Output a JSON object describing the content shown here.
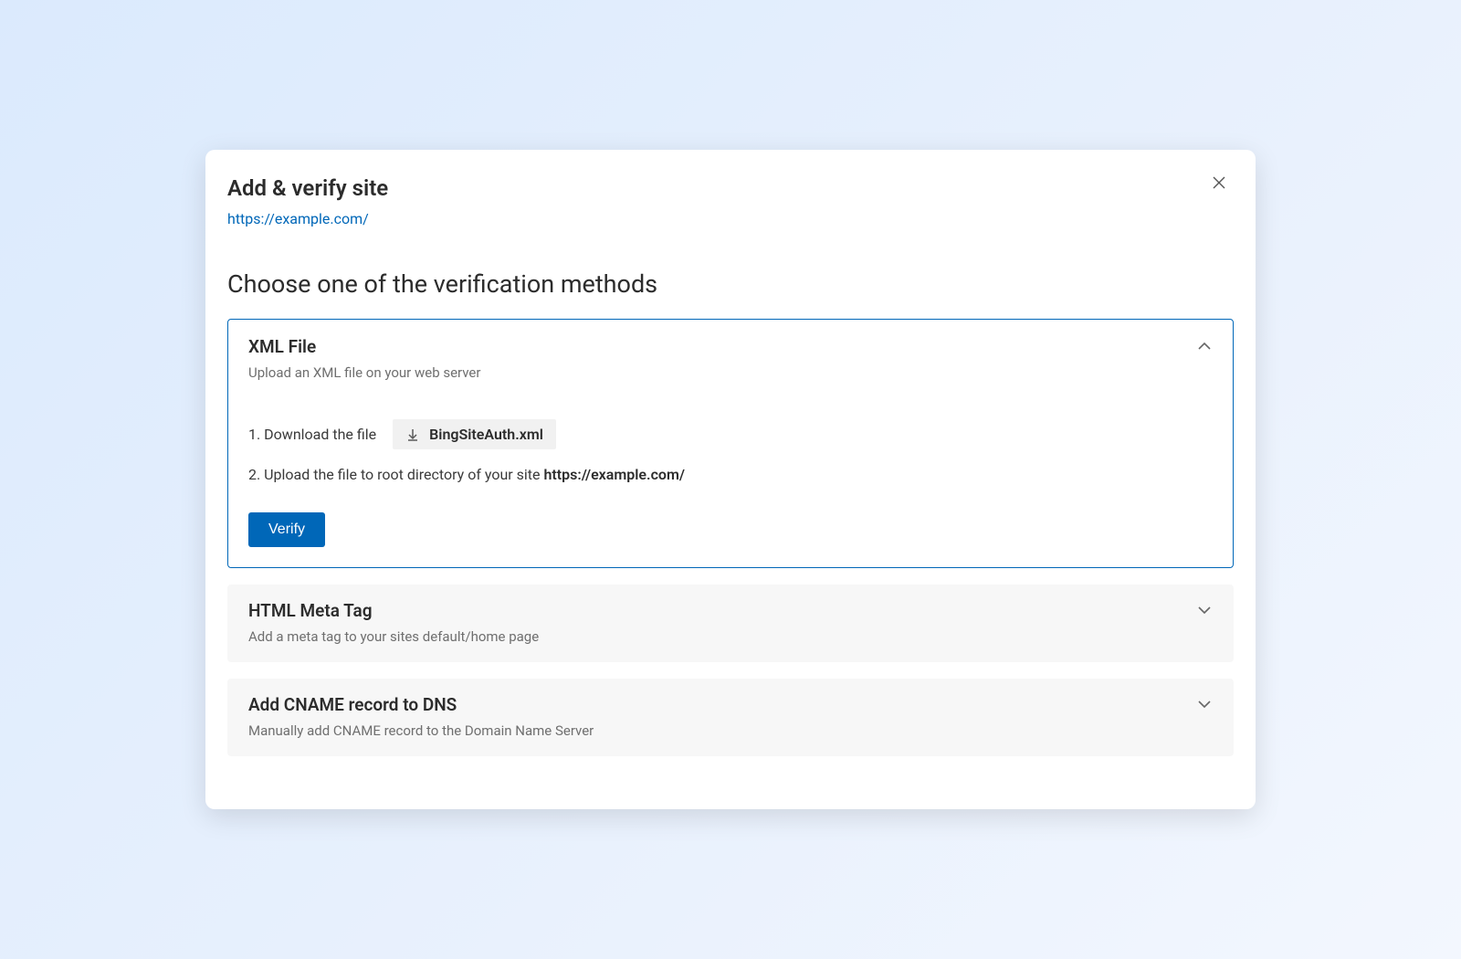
{
  "dialog": {
    "title": "Add & verify site",
    "site_url": "https://example.com/",
    "subtitle": "Choose one of the verification methods"
  },
  "methods": {
    "xml": {
      "title": "XML File",
      "desc": "Upload an XML file on your web server",
      "step1_label": "1. Download the file",
      "download_filename": "BingSiteAuth.xml",
      "step2_prefix": "2. Upload the file to root directory of your site ",
      "step2_url": "https://example.com/",
      "verify_label": "Verify"
    },
    "meta": {
      "title": "HTML Meta Tag",
      "desc": "Add a meta tag to your sites default/home page"
    },
    "cname": {
      "title": "Add CNAME record to DNS",
      "desc": "Manually add CNAME record to the Domain Name Server"
    }
  }
}
